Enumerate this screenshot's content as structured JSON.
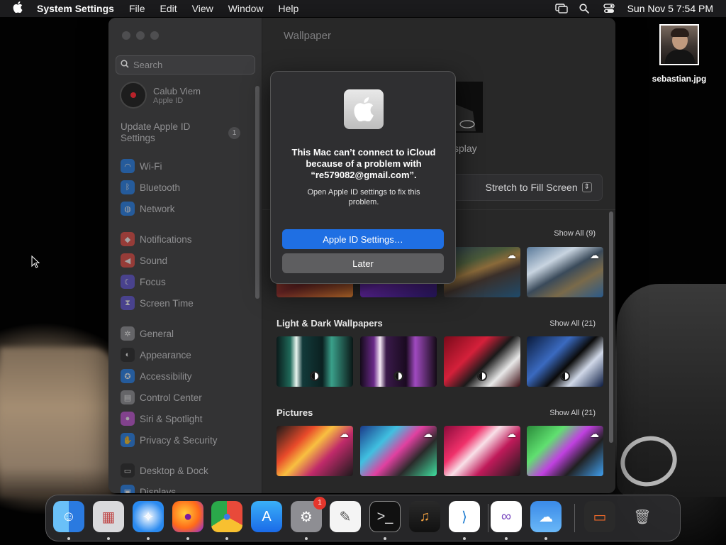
{
  "menubar": {
    "app_name": "System Settings",
    "items": [
      "File",
      "Edit",
      "View",
      "Window",
      "Help"
    ],
    "clock": "Sun Nov 5  7:54 PM"
  },
  "desktop": {
    "file_name": "sebastian.jpg"
  },
  "sidebar": {
    "search_placeholder": "Search",
    "account_name": "Calub Viem",
    "account_sub": "Apple ID",
    "update_label": "Update Apple ID Settings",
    "update_count": "1",
    "items": [
      {
        "label": "Wi-Fi",
        "icon": "wifi-icon",
        "color": "#1a7cf0"
      },
      {
        "label": "Bluetooth",
        "icon": "bluetooth-icon",
        "color": "#1a7cf0"
      },
      {
        "label": "Network",
        "icon": "globe-icon",
        "color": "#1a7cf0"
      },
      {
        "label": "Notifications",
        "icon": "bell-icon",
        "color": "#e8453c"
      },
      {
        "label": "Sound",
        "icon": "speaker-icon",
        "color": "#e8453c"
      },
      {
        "label": "Focus",
        "icon": "moon-icon",
        "color": "#5b4fd6"
      },
      {
        "label": "Screen Time",
        "icon": "hourglass-icon",
        "color": "#5b4fd6"
      },
      {
        "label": "General",
        "icon": "gear-icon",
        "color": "#8e8e93"
      },
      {
        "label": "Appearance",
        "icon": "contrast-icon",
        "color": "#1c1c1e"
      },
      {
        "label": "Accessibility",
        "icon": "accessibility-icon",
        "color": "#1a7cf0"
      },
      {
        "label": "Control Center",
        "icon": "control-center-icon",
        "color": "#8e8e93"
      },
      {
        "label": "Siri & Spotlight",
        "icon": "siri-icon",
        "color": "#c44fd6"
      },
      {
        "label": "Privacy & Security",
        "icon": "hand-icon",
        "color": "#1a7cf0"
      },
      {
        "label": "Desktop & Dock",
        "icon": "dock-icon",
        "color": "#1c1c1e"
      },
      {
        "label": "Displays",
        "icon": "display-icon",
        "color": "#1a7cf0"
      }
    ]
  },
  "main": {
    "title": "Wallpaper",
    "preview_label": "splay",
    "fill_mode": "Stretch to Fill Screen",
    "sections": [
      {
        "title": "",
        "show_all": "Show All (9)"
      },
      {
        "title": "Light & Dark Wallpapers",
        "show_all": "Show All (21)"
      },
      {
        "title": "Pictures",
        "show_all": "Show All (21)"
      }
    ]
  },
  "dialog": {
    "title": "This Mac can’t connect to iCloud because of a problem with “re579082@gmail.com”.",
    "message": "Open Apple ID settings to fix this problem.",
    "primary_button": "Apple ID Settings…",
    "secondary_button": "Later"
  },
  "dock": {
    "apps": [
      {
        "name": "Finder",
        "icon": "finder-icon"
      },
      {
        "name": "Launchpad",
        "icon": "launchpad-icon"
      },
      {
        "name": "Safari",
        "icon": "safari-icon"
      },
      {
        "name": "Firefox",
        "icon": "firefox-icon"
      },
      {
        "name": "Chrome",
        "icon": "chrome-icon"
      },
      {
        "name": "App Store",
        "icon": "app-store-icon"
      },
      {
        "name": "System Settings",
        "icon": "settings-icon",
        "badge": "1"
      },
      {
        "name": "TextEdit",
        "icon": "textedit-icon"
      },
      {
        "name": "Terminal",
        "icon": "terminal-icon"
      },
      {
        "name": "GarageBand",
        "icon": "garageband-icon"
      },
      {
        "name": "Visual Studio Code",
        "icon": "vscode-icon"
      },
      {
        "name": "Visual Studio",
        "icon": "visual-studio-icon"
      },
      {
        "name": "Weather",
        "icon": "weather-icon"
      },
      {
        "name": "Downloads",
        "icon": "downloads-stack-icon"
      },
      {
        "name": "Trash",
        "icon": "trash-icon"
      }
    ]
  }
}
